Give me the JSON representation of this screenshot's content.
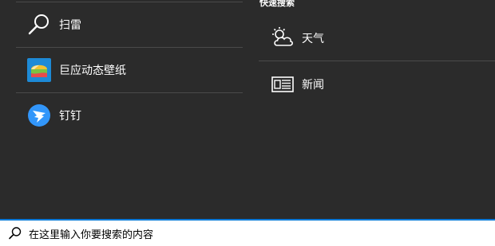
{
  "apps": [
    {
      "label": "扫雷",
      "icon": "search-magnifier-icon"
    },
    {
      "label": "巨应动态壁纸",
      "icon": "wallpaper-app-icon"
    },
    {
      "label": "钉钉",
      "icon": "dingtalk-icon"
    }
  ],
  "quick_search": {
    "title": "快速搜索",
    "items": [
      {
        "label": "天气",
        "icon": "weather-icon"
      },
      {
        "label": "新闻",
        "icon": "news-icon"
      }
    ]
  },
  "search": {
    "placeholder": "在这里输入你要搜索的内容"
  },
  "colors": {
    "background": "#2b2b2b",
    "accent": "#0078d7",
    "dingtalk": "#3296fa"
  }
}
